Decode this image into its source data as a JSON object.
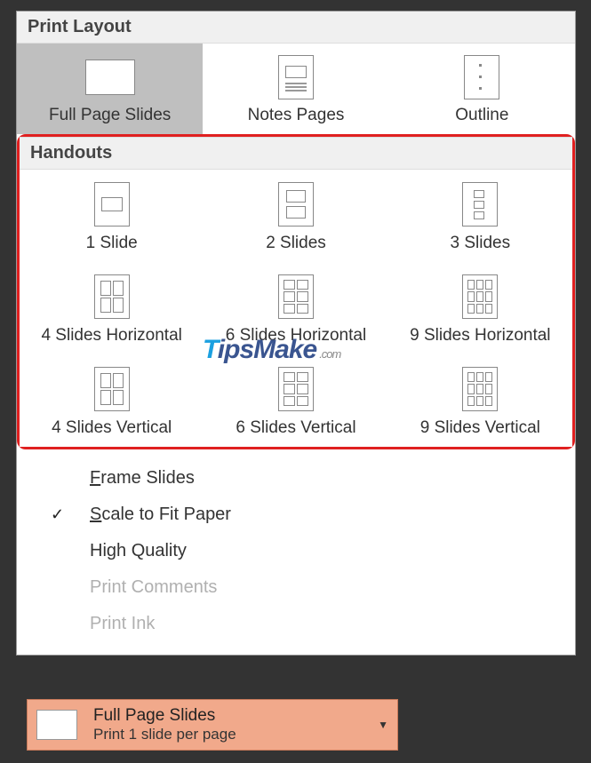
{
  "print_layout": {
    "header": "Print Layout",
    "items": [
      {
        "label": "Full Page Slides",
        "icon": "full-page",
        "selected": true
      },
      {
        "label": "Notes Pages",
        "icon": "notes-page",
        "selected": false
      },
      {
        "label": "Outline",
        "icon": "outline",
        "selected": false
      }
    ]
  },
  "handouts": {
    "header": "Handouts",
    "items": [
      {
        "label": "1 Slide",
        "icon": "h1"
      },
      {
        "label": "2 Slides",
        "icon": "h2"
      },
      {
        "label": "3 Slides",
        "icon": "h3"
      },
      {
        "label": "4 Slides Horizontal",
        "icon": "h4h"
      },
      {
        "label": "6 Slides Horizontal",
        "icon": "h6h"
      },
      {
        "label": "9 Slides Horizontal",
        "icon": "h9h"
      },
      {
        "label": "4 Slides Vertical",
        "icon": "h4v"
      },
      {
        "label": "6 Slides Vertical",
        "icon": "h6v"
      },
      {
        "label": "9 Slides Vertical",
        "icon": "h9v"
      }
    ]
  },
  "options": [
    {
      "label_pre": "F",
      "label_rest": "rame Slides",
      "checked": false,
      "disabled": false
    },
    {
      "label_pre": "S",
      "label_rest": "cale to Fit Paper",
      "checked": true,
      "disabled": false
    },
    {
      "label_pre": "",
      "label_rest": "High Quality",
      "checked": false,
      "disabled": false
    },
    {
      "label_pre": "",
      "label_rest": "Print Comments",
      "checked": false,
      "disabled": true
    },
    {
      "label_pre": "",
      "label_rest": "Print Ink",
      "checked": false,
      "disabled": true
    }
  ],
  "dropdown": {
    "title": "Full Page Slides",
    "subtitle": "Print 1 slide per page"
  },
  "watermark": {
    "t": "T",
    "rest": "ipsMake",
    "com": ".com"
  }
}
